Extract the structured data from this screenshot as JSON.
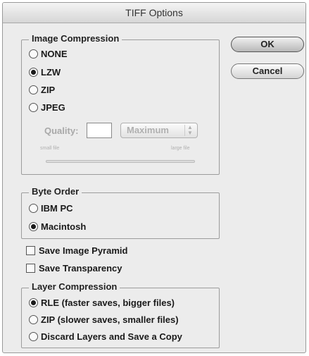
{
  "window": {
    "title": "TIFF Options"
  },
  "buttons": {
    "ok": "OK",
    "cancel": "Cancel"
  },
  "image_compression": {
    "title": "Image Compression",
    "options": [
      {
        "label": "NONE",
        "selected": false
      },
      {
        "label": "LZW",
        "selected": true
      },
      {
        "label": "ZIP",
        "selected": false
      },
      {
        "label": "JPEG",
        "selected": false
      }
    ],
    "quality": {
      "label": "Quality:",
      "value": "",
      "select_value": "Maximum",
      "small_file_label": "small file",
      "large_file_label": "large file"
    }
  },
  "byte_order": {
    "title": "Byte Order",
    "options": [
      {
        "label": "IBM PC",
        "selected": false
      },
      {
        "label": "Macintosh",
        "selected": true
      }
    ]
  },
  "checkboxes": [
    {
      "label": "Save Image Pyramid",
      "checked": false
    },
    {
      "label": "Save Transparency",
      "checked": false
    }
  ],
  "layer_compression": {
    "title": "Layer Compression",
    "options": [
      {
        "label": "RLE (faster saves, bigger files)",
        "selected": true
      },
      {
        "label": "ZIP (slower saves, smaller files)",
        "selected": false
      },
      {
        "label": "Discard Layers and Save a Copy",
        "selected": false
      }
    ]
  }
}
